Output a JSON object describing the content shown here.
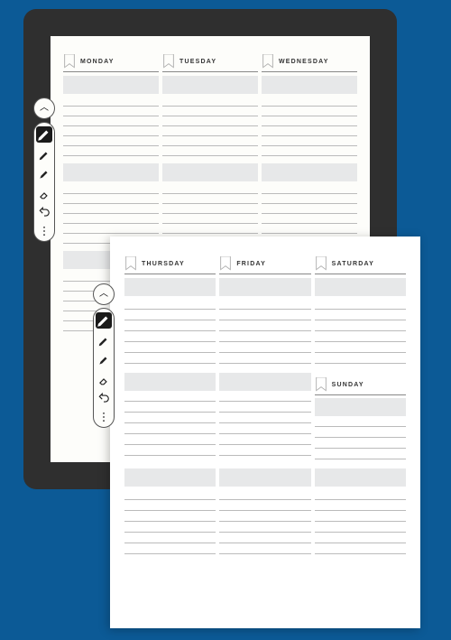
{
  "page1": {
    "days": [
      "MONDAY",
      "TUESDAY",
      "WEDNESDAY"
    ]
  },
  "page2": {
    "days": [
      "THURSDAY",
      "FRIDAY",
      "SATURDAY"
    ],
    "sunday": "SUNDAY"
  },
  "toolbar": {
    "collapse": "^",
    "tools": [
      "pen",
      "pen2",
      "highlighter",
      "eraser",
      "undo",
      "more"
    ]
  }
}
